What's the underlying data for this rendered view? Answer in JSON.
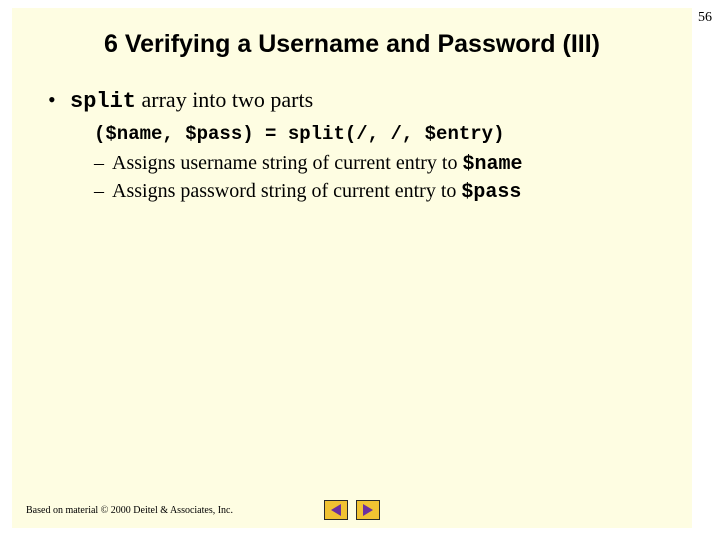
{
  "page_number": "56",
  "title": "6 Verifying a Username and Password (III)",
  "bullet": {
    "code_word": "split",
    "rest": " array into two parts"
  },
  "sub": {
    "code_line": "($name, $pass) = split(/, /, $entry)",
    "dash1": {
      "pre": "Assigns username string of current entry to ",
      "code": "$name"
    },
    "dash2": {
      "pre": "Assigns password string of current entry to ",
      "code": "$pass"
    }
  },
  "footer": "Based on material © 2000 Deitel & Associates, Inc."
}
